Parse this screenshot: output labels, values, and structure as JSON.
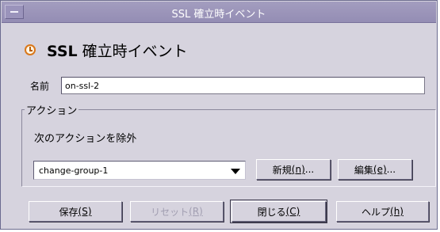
{
  "window": {
    "title": "SSL 確立時イベント"
  },
  "header": {
    "title_bold": "SSL",
    "title_rest": " 確立時イベント"
  },
  "form": {
    "name_label": "名前",
    "name_value": "on-ssl-2"
  },
  "actions": {
    "legend": "アクション",
    "description": "次のアクションを除外",
    "selected": "change-group-1",
    "new_button": {
      "label": "新規",
      "mnemonic": "(n)",
      "suffix": "..."
    },
    "edit_button": {
      "label": "編集",
      "mnemonic": "(e)",
      "suffix": "..."
    }
  },
  "footer": {
    "save": {
      "label": "保存",
      "mnemonic": "(S)"
    },
    "reset": {
      "label": "リセット",
      "mnemonic": "(R)"
    },
    "close": {
      "label": "閉じる",
      "mnemonic": "(C)"
    },
    "help": {
      "label": "ヘルプ",
      "mnemonic": "(h)"
    }
  }
}
